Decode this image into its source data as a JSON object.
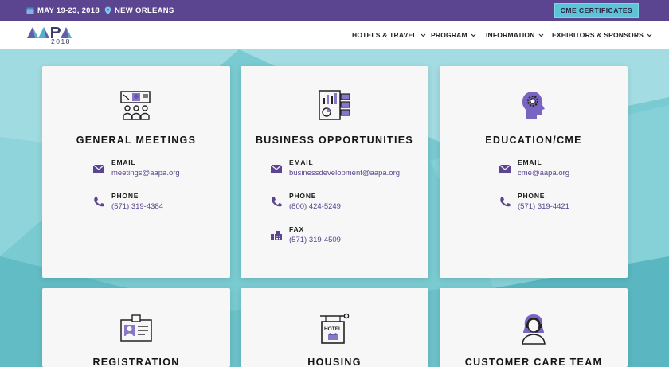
{
  "topbar": {
    "date": "MAY 19-23, 2018",
    "location": "NEW ORLEANS",
    "cme_label": "CME CERTIFICATES"
  },
  "logo": {
    "year": "2018"
  },
  "nav": {
    "items": [
      {
        "label": "HOTELS & TRAVEL"
      },
      {
        "label": "PROGRAM"
      },
      {
        "label": "INFORMATION"
      },
      {
        "label": "EXHIBITORS & SPONSORS"
      }
    ]
  },
  "cards": [
    {
      "title": "GENERAL MEETINGS",
      "icon": "meeting-icon",
      "contacts": [
        {
          "label": "EMAIL",
          "value": "meetings@aapa.org",
          "icon": "envelope-icon"
        },
        {
          "label": "PHONE",
          "value": "(571) 319-4384",
          "icon": "phone-icon"
        }
      ]
    },
    {
      "title": "BUSINESS OPPORTUNITIES",
      "icon": "dashboard-icon",
      "contacts": [
        {
          "label": "EMAIL",
          "value": "businessdevelopment@aapa.org",
          "icon": "envelope-icon"
        },
        {
          "label": "PHONE",
          "value": "(800) 424-5249",
          "icon": "phone-icon"
        },
        {
          "label": "FAX",
          "value": "(571) 319-4509",
          "icon": "fax-icon"
        }
      ]
    },
    {
      "title": "EDUCATION/CME",
      "icon": "head-gear-icon",
      "contacts": [
        {
          "label": "EMAIL",
          "value": "cme@aapa.org",
          "icon": "envelope-icon"
        },
        {
          "label": "PHONE",
          "value": "(571) 319-4421",
          "icon": "phone-icon"
        }
      ]
    },
    {
      "title": "REGISTRATION",
      "icon": "id-card-icon",
      "contacts": []
    },
    {
      "title": "HOUSING",
      "icon": "hotel-sign-icon",
      "contacts": []
    },
    {
      "title": "CUSTOMER CARE TEAM",
      "icon": "headset-agent-icon",
      "contacts": []
    }
  ],
  "colors": {
    "topbar": "#5b4591",
    "accent": "#5cc4d6",
    "link": "#5b4591",
    "background": "#79cbd1",
    "card": "#f7f7f7"
  }
}
